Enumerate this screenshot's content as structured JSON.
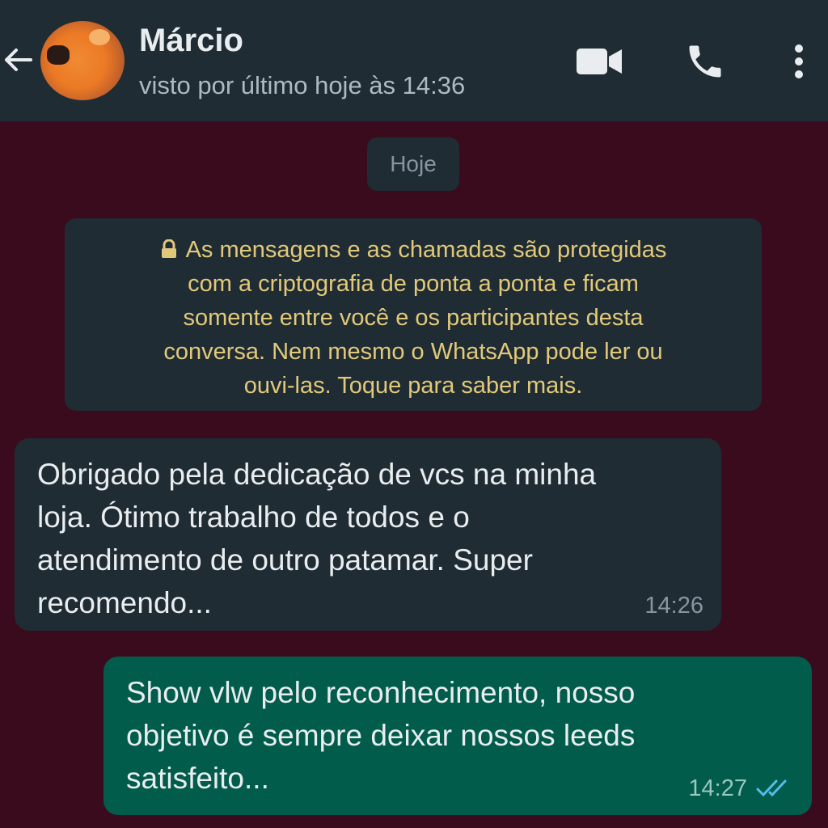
{
  "header": {
    "contact_name": "Márcio",
    "status": "visto por último hoje às 14:36"
  },
  "date_chip": "Hoje",
  "encryption_notice": "As mensagens e as chamadas são protegidas\ncom a criptografia de ponta a ponta e ficam\nsomente entre você e os participantes desta\nconversa. Nem mesmo o WhatsApp pode ler ou\nouvi-las. Toque para saber mais.",
  "messages": [
    {
      "direction": "incoming",
      "text": "Obrigado pela dedicação de vcs na minha\nloja. Ótimo trabalho de todos e o\natendimento de outro patamar. Super\nrecomendo...",
      "time": "14:26"
    },
    {
      "direction": "outgoing",
      "text": "Show vlw pelo reconhecimento, nosso\nobjetivo é sempre deixar nossos leeds\nsatisfeito...",
      "time": "14:27",
      "status_icon": "double-check-read-icon"
    }
  ],
  "icons": {
    "back": "arrow-left-icon",
    "video_call": "video-camera-icon",
    "voice_call": "phone-icon",
    "menu": "more-vertical-icon",
    "lock": "lock-icon"
  },
  "colors": {
    "header_bg": "#1f2c34",
    "chat_bg": "#3a0b1c",
    "incoming_bubble": "#1f2c34",
    "outgoing_bubble": "#015c4b",
    "encryption_text": "#e2c97a",
    "read_ticks": "#53bdeb"
  }
}
